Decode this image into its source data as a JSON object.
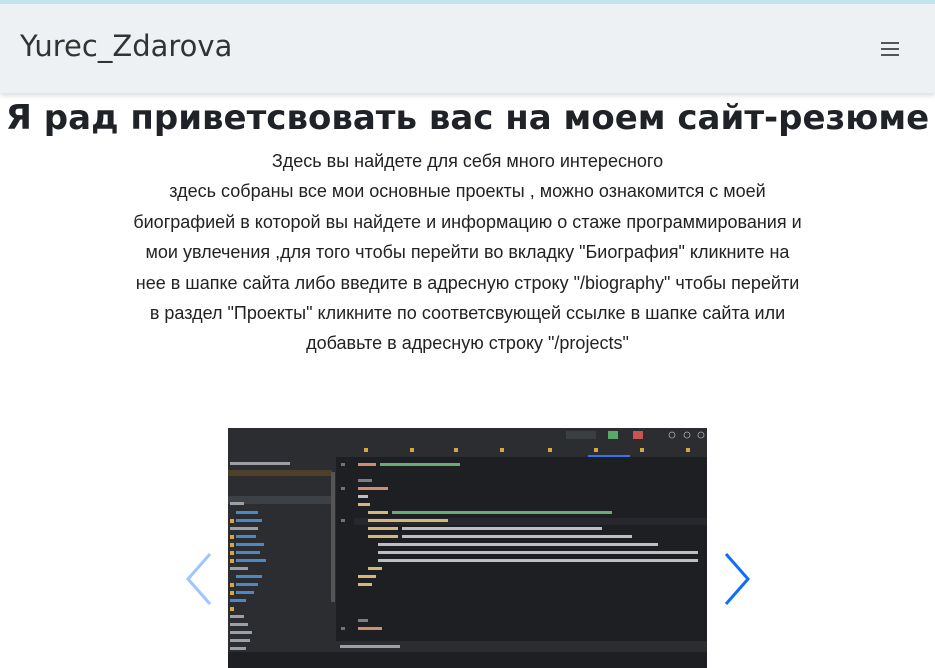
{
  "navbar": {
    "brand": "Yurec_Zdarova",
    "menu_icon": "hamburger-icon"
  },
  "heading": "Я рад приветсвовать вас на моем сайт-резюме",
  "intro_lines": [
    "Здесь вы найдете для себя много интересного",
    "здесь собраны все мои основные проекты , можно ознакомится с моей",
    "биографией в которой вы найдете и информацию о стаже программирования и",
    "мои увлечения ,для того чтобы перейти во вкладку \"Биография\" кликните на",
    "нее в шапке сайта либо введите в адресную строку \"/biography\" чтобы перейти",
    "в раздел \"Проекты\" кликните по соответсвующей ссылке в шапке сайта или",
    "добавьте в адресную строку \"/projects\""
  ],
  "carousel": {
    "prev_icon": "chevron-left-icon",
    "next_icon": "chevron-right-icon",
    "slide_alt": "IDE screenshot"
  },
  "colors": {
    "navbar_bg": "#eef1f4",
    "accent": "#0d6efd",
    "arrow_left": "#9ec5fe",
    "ide_bg": "#1e1f22"
  }
}
